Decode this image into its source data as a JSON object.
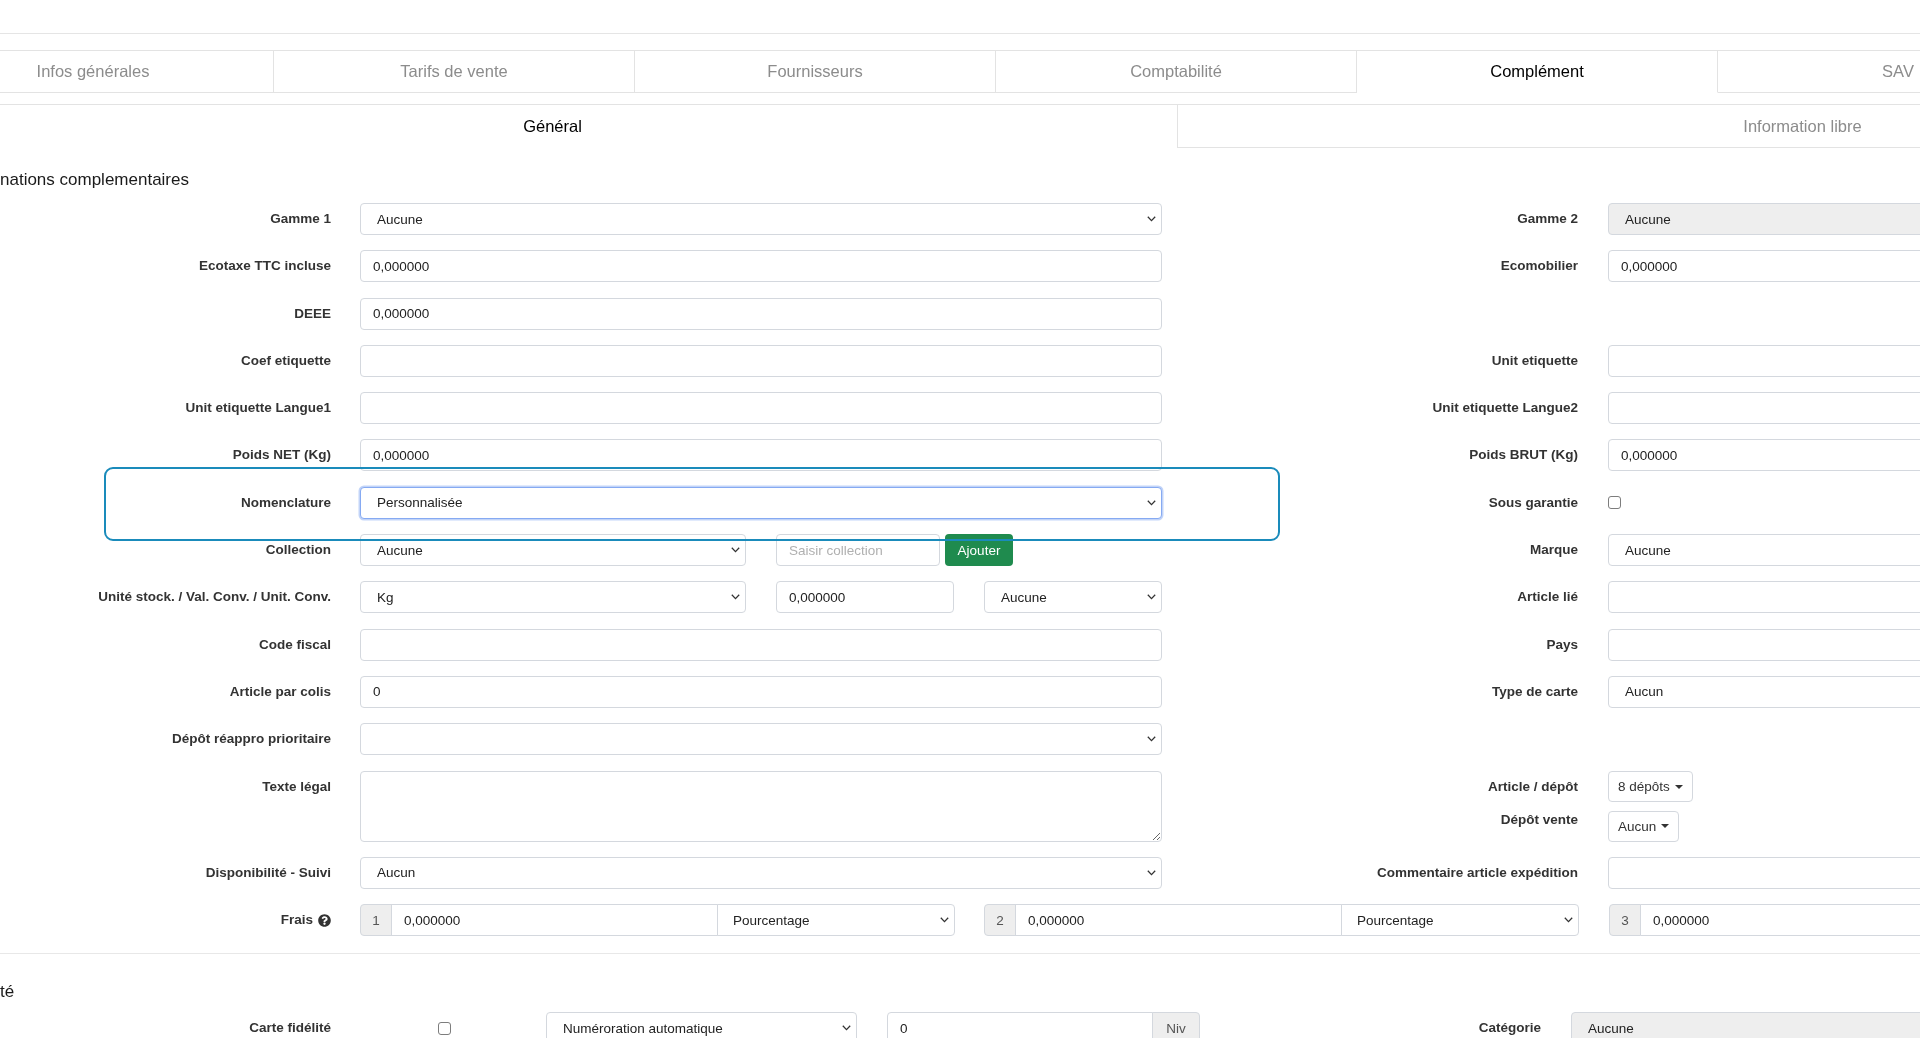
{
  "tabs": [
    {
      "label": "Infos générales",
      "selected": false
    },
    {
      "label": "Tarifs de vente",
      "selected": false
    },
    {
      "label": "Fournisseurs",
      "selected": false
    },
    {
      "label": "Comptabilité",
      "selected": false
    },
    {
      "label": "Complément",
      "selected": true
    },
    {
      "label": "SAV",
      "selected": false
    }
  ],
  "subtabs": [
    {
      "label": "Général",
      "selected": true
    },
    {
      "label": "Information libre",
      "selected": false
    }
  ],
  "sections": [
    {
      "title": "nations complementaires",
      "rows": [
        {
          "kind": "field",
          "label": "Gamme 1",
          "highlighted": false,
          "controls": [
            {
              "kind": "select",
              "value": "Aucune",
              "disabled": false,
              "focused": false
            }
          ],
          "right": [
            {
              "label": "Gamme 2",
              "control": {
                "kind": "select",
                "value": "Aucune",
                "disabled": true,
                "focused": false
              }
            }
          ]
        },
        {
          "kind": "field",
          "label": "Ecotaxe TTC incluse",
          "highlighted": false,
          "controls": [
            {
              "kind": "input",
              "value": "0,000000",
              "focused": false
            }
          ],
          "right": [
            {
              "label": "Ecomobilier",
              "control": {
                "kind": "input",
                "value": "0,000000",
                "focused": false
              }
            }
          ]
        },
        {
          "kind": "field",
          "label": "DEEE",
          "highlighted": false,
          "controls": [
            {
              "kind": "input",
              "value": "0,000000",
              "focused": false
            }
          ]
        },
        {
          "kind": "field",
          "label": "Coef etiquette",
          "highlighted": false,
          "controls": [
            {
              "kind": "input",
              "focused": false
            }
          ],
          "right": [
            {
              "label": "Unit etiquette",
              "control": {
                "kind": "input",
                "focused": false
              }
            }
          ]
        },
        {
          "kind": "field",
          "label": "Unit etiquette Langue1",
          "highlighted": false,
          "controls": [
            {
              "kind": "input",
              "focused": false
            }
          ],
          "right": [
            {
              "label": "Unit etiquette Langue2",
              "control": {
                "kind": "input",
                "focused": false
              }
            }
          ]
        },
        {
          "kind": "field",
          "label": "Poids NET (Kg)",
          "highlighted": false,
          "controls": [
            {
              "kind": "input",
              "value": "0,000000",
              "focused": false
            }
          ],
          "right": [
            {
              "label": "Poids BRUT (Kg)",
              "control": {
                "kind": "input",
                "value": "0,000000",
                "focused": false
              }
            }
          ]
        },
        {
          "kind": "field",
          "label": "Nomenclature",
          "highlighted": true,
          "controls": [
            {
              "kind": "select",
              "value": "Personnalisée",
              "disabled": false,
              "focused": true
            }
          ],
          "right": [
            {
              "label": "Sous garantie",
              "control": {
                "kind": "checkbox",
                "checked": false
              }
            }
          ]
        },
        {
          "kind": "field-add",
          "label": "Collection",
          "highlighted": false,
          "controls": [
            {
              "kind": "select",
              "value": "Aucune",
              "disabled": false,
              "focused": false
            },
            {
              "kind": "input",
              "placeholder": "Saisir collection",
              "focused": false
            },
            {
              "kind": "button",
              "label": "Ajouter"
            }
          ],
          "right": [
            {
              "label": "Marque",
              "control": {
                "kind": "select",
                "value": "Aucune",
                "disabled": false,
                "focused": false
              }
            }
          ]
        },
        {
          "kind": "field-conversion",
          "label": "Unité stock. / Val. Conv. / Unit. Conv.",
          "highlighted": false,
          "controls": [
            {
              "kind": "select",
              "value": "Kg",
              "disabled": false,
              "focused": false
            },
            {
              "kind": "input",
              "value": "0,000000",
              "focused": false
            },
            {
              "kind": "select",
              "value": "Aucune",
              "disabled": false,
              "focused": false
            }
          ],
          "right": [
            {
              "label": "Article lié",
              "control": {
                "kind": "input",
                "focused": false
              }
            }
          ]
        },
        {
          "kind": "field",
          "label": "Code fiscal",
          "highlighted": false,
          "controls": [
            {
              "kind": "input",
              "focused": false
            }
          ],
          "right": [
            {
              "label": "Pays",
              "control": {
                "kind": "input",
                "focused": false
              }
            }
          ]
        },
        {
          "kind": "field",
          "label": "Article par colis",
          "highlighted": false,
          "controls": [
            {
              "kind": "input",
              "value": "0",
              "focused": false
            }
          ],
          "right": [
            {
              "label": "Type de carte",
              "control": {
                "kind": "select",
                "value": "Aucun",
                "disabled": false,
                "focused": false
              }
            }
          ]
        },
        {
          "kind": "field",
          "label": "Dépôt réappro prioritaire",
          "highlighted": false,
          "controls": [
            {
              "kind": "select",
              "disabled": false,
              "focused": false
            }
          ]
        },
        {
          "kind": "field",
          "label": "Texte légal",
          "highlighted": false,
          "controls": [
            {
              "kind": "textarea",
              "focused": false
            }
          ],
          "right": [
            {
              "label": "Article / dépôt",
              "control": {
                "kind": "dropdown",
                "label": "8 dépôts"
              }
            },
            {
              "label": "Dépôt vente",
              "control": {
                "kind": "dropdown",
                "label": "Aucun"
              }
            }
          ]
        },
        {
          "kind": "field",
          "label": "Disponibilité - Suivi",
          "highlighted": false,
          "controls": [
            {
              "kind": "select",
              "value": "Aucun",
              "disabled": false,
              "focused": false
            }
          ],
          "right": [
            {
              "label": "Commentaire article expédition",
              "control": {
                "kind": "input",
                "focused": false
              }
            }
          ]
        },
        {
          "kind": "fees",
          "label": "Frais",
          "highlighted": false,
          "groups": [
            {
              "addon": "1",
              "value": "0,000000",
              "unit": "Pourcentage"
            },
            {
              "addon": "2",
              "value": "0,000000",
              "unit": "Pourcentage"
            },
            {
              "addon": "3",
              "value": "0,000000"
            }
          ]
        }
      ]
    },
    {
      "title": "té",
      "rows": [
        {
          "kind": "loyalty",
          "label": "Carte fidélité",
          "highlighted": false,
          "controls": [
            {
              "kind": "checkbox",
              "checked": false
            },
            {
              "kind": "select",
              "value": "Numéroration automatique",
              "disabled": false,
              "focused": false
            },
            {
              "kind": "input",
              "value": "0",
              "addon": "Niv",
              "focused": false
            }
          ],
          "right": [
            {
              "label": "Catégorie",
              "control": {
                "kind": "select",
                "value": "Aucune",
                "disabled": true,
                "focused": false
              }
            }
          ]
        }
      ]
    }
  ]
}
